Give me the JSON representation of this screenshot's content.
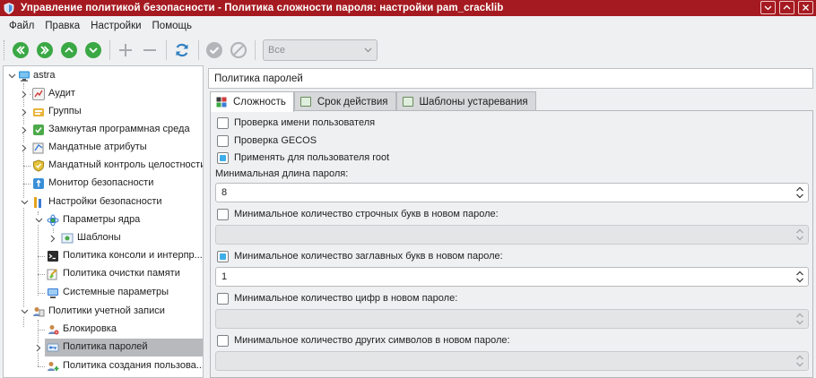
{
  "window": {
    "title": "Управление политикой безопасности - Политика сложности пароля: настройки pam_cracklib",
    "colors": {
      "titlebar": "#a51a20",
      "accent": "#3daee9",
      "toolbar_green": "#3aa845",
      "selection": "#b7b9bc"
    }
  },
  "menu": [
    "Файл",
    "Правка",
    "Настройки",
    "Помощь"
  ],
  "toolbar": {
    "icons": [
      "first-icon",
      "prev-icon",
      "up-icon",
      "down-icon",
      "add-icon",
      "remove-icon",
      "refresh-icon",
      "apply-icon",
      "cancel-icon"
    ],
    "filter": {
      "value": "Все"
    }
  },
  "tree": {
    "items": [
      {
        "label": "astra",
        "icon": "computer-icon"
      },
      {
        "label": "Аудит",
        "icon": "audit-icon"
      },
      {
        "label": "Группы",
        "icon": "groups-icon"
      },
      {
        "label": "Замкнутая программная среда",
        "icon": "closed-env-icon"
      },
      {
        "label": "Мандатные атрибуты",
        "icon": "mandatory-attr-icon"
      },
      {
        "label": "Мандатный контроль целостности",
        "icon": "integrity-icon"
      },
      {
        "label": "Монитор безопасности",
        "icon": "monitor-icon"
      },
      {
        "label": "Настройки безопасности",
        "icon": "security-settings-icon"
      },
      {
        "label": "Параметры ядра",
        "icon": "kernel-icon"
      },
      {
        "label": "Шаблоны",
        "icon": "templates-icon"
      },
      {
        "label": "Политика консоли и интерпр...",
        "icon": "console-icon"
      },
      {
        "label": "Политика очистки памяти",
        "icon": "memory-clean-icon"
      },
      {
        "label": "Системные параметры",
        "icon": "system-params-icon"
      },
      {
        "label": "Политики учетной записи",
        "icon": "account-policy-icon"
      },
      {
        "label": "Блокировка",
        "icon": "lock-icon"
      },
      {
        "label": "Политика паролей",
        "icon": "password-policy-icon"
      },
      {
        "label": "Политика создания пользова...",
        "icon": "user-create-icon"
      }
    ]
  },
  "right": {
    "section_title": "Политика паролей",
    "tabs": [
      {
        "label": "Сложность",
        "active": true
      },
      {
        "label": "Срок действия",
        "active": false
      },
      {
        "label": "Шаблоны устаревания",
        "active": false
      }
    ],
    "checks": {
      "username": {
        "label": "Проверка имени пользователя",
        "checked": false
      },
      "gecos": {
        "label": "Проверка GECOS",
        "checked": false
      },
      "root": {
        "label": "Применять для пользователя root",
        "checked": true
      }
    },
    "min_length": {
      "label": "Минимальная длина пароля:",
      "value": "8"
    },
    "lowercase": {
      "label": "Минимальное количество строчных букв в новом пароле:",
      "checked": false,
      "value": ""
    },
    "uppercase": {
      "label": "Минимальное количество заглавных букв в новом пароле:",
      "checked": true,
      "value": "1"
    },
    "digits": {
      "label": "Минимальное количество цифр в новом пароле:",
      "checked": false,
      "value": ""
    },
    "other": {
      "label": "Минимальное количество других символов в новом пароле:",
      "checked": false,
      "value": ""
    }
  }
}
